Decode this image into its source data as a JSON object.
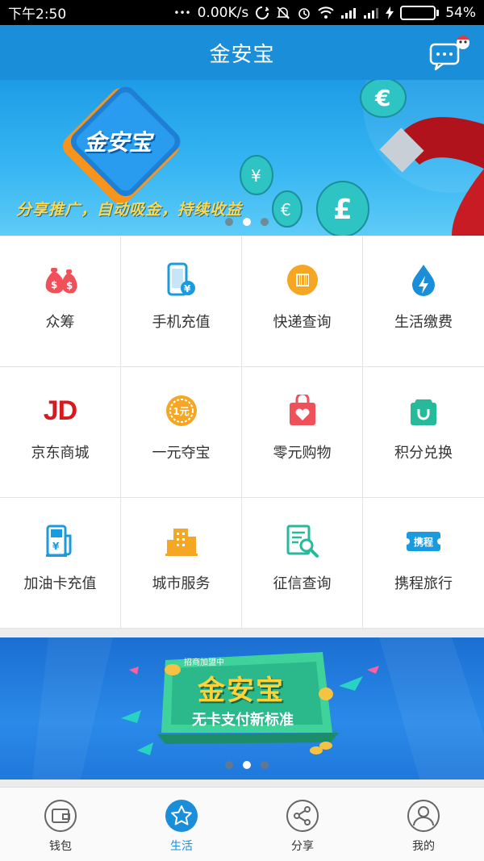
{
  "status_bar": {
    "time": "下午2:50",
    "dots": "•••",
    "network_speed": "0.00K/s",
    "battery_percent": "54%",
    "battery_level": 0.54
  },
  "header": {
    "title": "金安宝",
    "chat_icon": "chat-bubble-icon"
  },
  "banner_top": {
    "caption": "分享推广，自动吸金，持续收益",
    "logo_text": "金安宝",
    "slide_count": 3,
    "active_slide": 2
  },
  "services": [
    {
      "label": "众筹",
      "icon": "money-bags-icon",
      "color": "#f0505a"
    },
    {
      "label": "手机充值",
      "icon": "phone-recharge-icon",
      "color": "#1a9be0"
    },
    {
      "label": "快递查询",
      "icon": "parcel-barcode-icon",
      "color": "#f5a623"
    },
    {
      "label": "生活缴费",
      "icon": "water-bolt-icon",
      "color": "#1a8ed8"
    },
    {
      "label": "京东商城",
      "icon": "jd-logo-icon",
      "color": "#d71920",
      "logo_text": "JD"
    },
    {
      "label": "一元夺宝",
      "icon": "one-yuan-coin-icon",
      "color": "#f5a623",
      "logo_text": "1元"
    },
    {
      "label": "零元购物",
      "icon": "heart-bag-icon",
      "color": "#f0505a"
    },
    {
      "label": "积分兑换",
      "icon": "shopping-bag-icon",
      "color": "#26b99a"
    },
    {
      "label": "加油卡充值",
      "icon": "fuel-pump-icon",
      "color": "#1a9be0"
    },
    {
      "label": "城市服务",
      "icon": "city-building-icon",
      "color": "#f5a623"
    },
    {
      "label": "征信查询",
      "icon": "document-search-icon",
      "color": "#26b99a"
    },
    {
      "label": "携程旅行",
      "icon": "ctrip-ticket-icon",
      "color": "#1a9be0",
      "logo_text": "携程"
    }
  ],
  "banner_bottom": {
    "tag": "招商加盟中",
    "title": "金安宝",
    "subtitle": "无卡支付新标准",
    "slide_count": 3,
    "active_slide": 2
  },
  "bottom_nav": [
    {
      "label": "钱包",
      "icon": "wallet-icon",
      "active": false
    },
    {
      "label": "生活",
      "icon": "star-icon",
      "active": true
    },
    {
      "label": "分享",
      "icon": "share-icon",
      "active": false
    },
    {
      "label": "我的",
      "icon": "profile-icon",
      "active": false
    }
  ],
  "colors": {
    "primary": "#1a8ed8",
    "status_bar": "#000000",
    "banner_caption": "#ffd84a"
  }
}
